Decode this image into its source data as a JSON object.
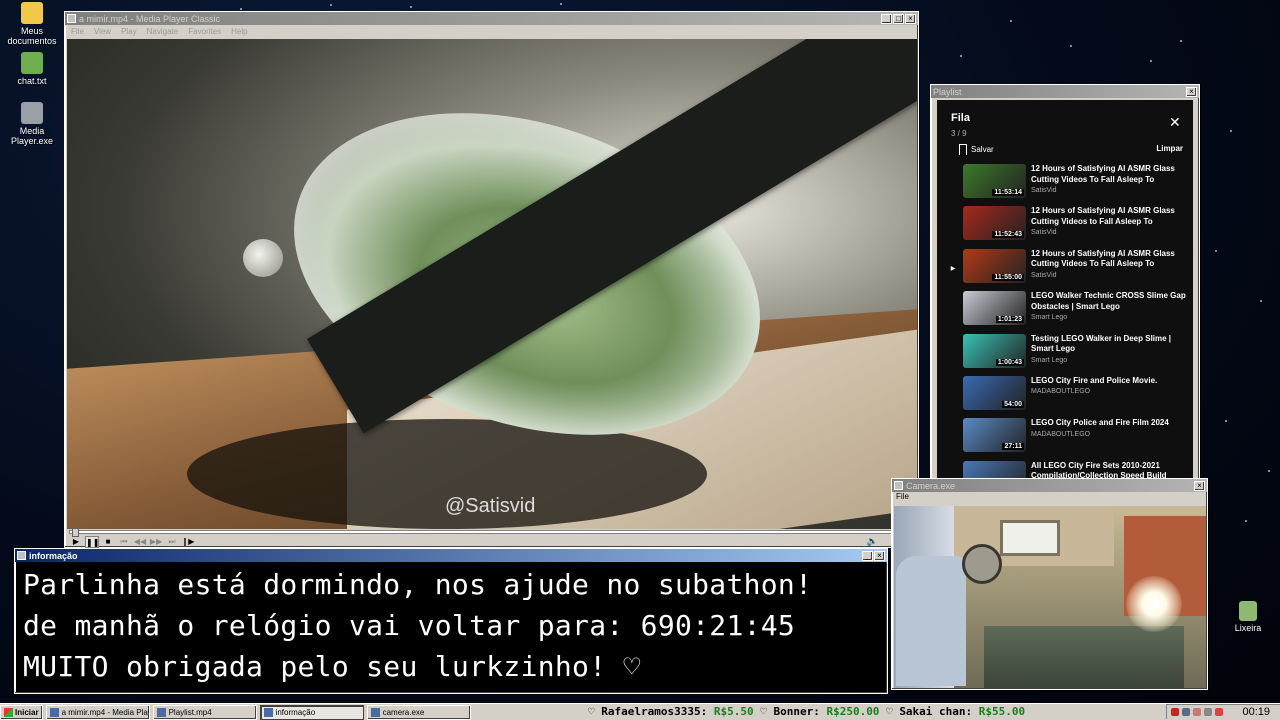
{
  "desktop": {
    "icons": [
      {
        "label": "Meus documentos",
        "icon": "folder-icon",
        "color": "#f2c84b"
      },
      {
        "label": "chat.txt",
        "icon": "notepad-icon",
        "color": "#6fae4e"
      },
      {
        "label": "Media Player.exe",
        "icon": "media-player-icon",
        "color": "#9aa0a8"
      },
      {
        "label": "Lixeira",
        "icon": "recycle-bin-icon",
        "color": "#8fb870"
      }
    ]
  },
  "media_player": {
    "title": "a mimir.mp4 - Media Player Classic",
    "menu": [
      "File",
      "View",
      "Play",
      "Navigate",
      "Favorites",
      "Help"
    ],
    "watermark": "@Satisvid",
    "progress": 0.0
  },
  "playlist": {
    "window_title": "Playlist",
    "heading": "Fila",
    "count": "3 / 9",
    "save_label": "Salvar",
    "clear_label": "Limpar",
    "items": [
      {
        "title": "12 Hours of Satisfying AI ASMR Glass Cutting Videos To Fall Asleep To",
        "channel": "SatisVid",
        "duration": "11:53:14",
        "thumb": "#3c7a2a",
        "playing": false
      },
      {
        "title": "12 Hours of Satisfying AI ASMR Glass Cutting Videos to Fall Asleep To",
        "channel": "SatisVid",
        "duration": "11:52:43",
        "thumb": "#a8281c",
        "playing": false
      },
      {
        "title": "12 Hours of Satisfying AI ASMR Glass Cutting Videos To Fall Asleep To",
        "channel": "SatisVid",
        "duration": "11:55:00",
        "thumb": "#b23a16",
        "playing": true
      },
      {
        "title": "LEGO Walker Technic CROSS Slime Gap Obstacles | Smart Lego",
        "channel": "Smart Lego",
        "duration": "1:01:23",
        "thumb": "#c9ccd4",
        "playing": false
      },
      {
        "title": "Testing LEGO Walker in Deep Slime | Smart Lego",
        "channel": "Smart Lego",
        "duration": "1:00:43",
        "thumb": "#38c4b6",
        "playing": false
      },
      {
        "title": "LEGO City Fire and Police Movie.",
        "channel": "MADABOUTLEGO",
        "duration": "54:00",
        "thumb": "#3a6ab4",
        "playing": false
      },
      {
        "title": "LEGO City Police and Fire Film 2024",
        "channel": "MADABOUTLEGO",
        "duration": "27:11",
        "thumb": "#5a8ac8",
        "playing": false
      },
      {
        "title": "All LEGO City Fire Sets 2010-2021 Compilation/Collection Speed Build",
        "channel": "",
        "duration": "",
        "thumb": "#4a78b8",
        "playing": false
      }
    ]
  },
  "camera": {
    "title": "Camera.exe",
    "menu_file": "File"
  },
  "info": {
    "title": "informação",
    "line1": "Parlinha está dormindo, nos ajude no subathon!",
    "line2": "de manhã o relógio vai voltar para:  690:21:45",
    "line3": "MUITO obrigada pelo seu lurkzinho! ♡"
  },
  "taskbar": {
    "start_label": "Iniciar",
    "tasks": [
      {
        "label": "a mimir.mp4 - Media Playe...",
        "active": false
      },
      {
        "label": "Playlist.mp4",
        "active": false
      },
      {
        "label": "informação",
        "active": true
      },
      {
        "label": "camera.exe",
        "active": false
      }
    ],
    "donations": [
      {
        "name": "Rafaelramos3335:",
        "amount": "R$5.50"
      },
      {
        "name": "Bonner:",
        "amount": "R$250.00"
      },
      {
        "name": "Sakai chan:",
        "amount": "R$55.00"
      }
    ],
    "clock": "00:19"
  }
}
